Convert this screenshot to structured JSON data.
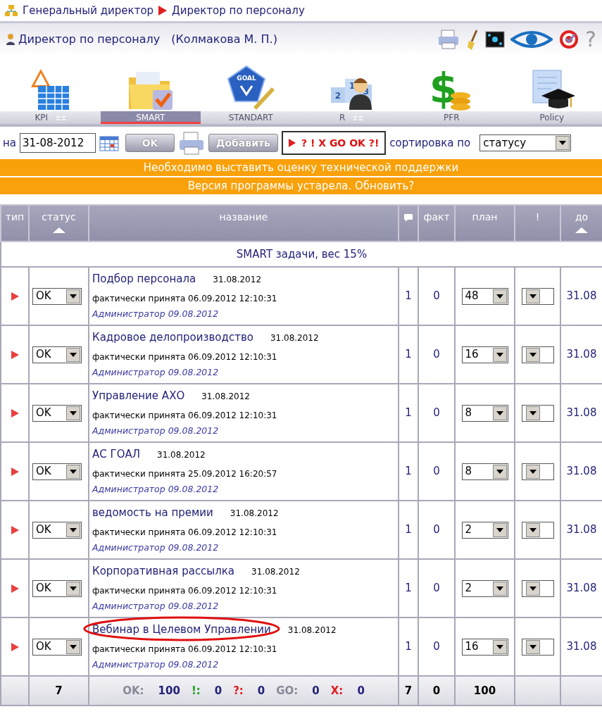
{
  "breadcrumb": [
    {
      "label": "Генеральный директор"
    },
    {
      "label": "Директор по персоналу"
    }
  ],
  "header": {
    "title": "Директор по персоналу",
    "person": "(Колмакова М. П.)",
    "help": "?"
  },
  "modules": [
    {
      "kind": "kpi"
    },
    {
      "kind": "smart"
    },
    {
      "kind": "goal",
      "badge": "GOAL"
    },
    {
      "kind": "rank",
      "podium": [
        "2",
        "1",
        "3"
      ]
    },
    {
      "kind": "money",
      "symbol": "$"
    },
    {
      "kind": "policy"
    }
  ],
  "tabs": [
    {
      "label": "KPI",
      "has_menu": true,
      "selected": false
    },
    {
      "label": "SMART",
      "has_menu": false,
      "selected": true
    },
    {
      "label": "STANDART",
      "has_menu": false,
      "selected": false
    },
    {
      "label": "R",
      "has_menu": true,
      "selected": false
    },
    {
      "label": "PFR",
      "has_menu": false,
      "selected": false
    },
    {
      "label": "Policy",
      "has_menu": false,
      "selected": false
    }
  ],
  "toolbar": {
    "date_label": "на",
    "date": "31-08-2012",
    "ok": "OK",
    "add": "Добавить",
    "filter": "? ! X GO OK ?!",
    "sort_label": "сортировка по",
    "sort_value": "статусу"
  },
  "notices": [
    "Необходимо выставить оценку технической поддержки",
    "Версия программы устарела. Обновить?"
  ],
  "table": {
    "columns": [
      {
        "label": "тип",
        "sorted": false
      },
      {
        "label": "статус",
        "sorted": true
      },
      {
        "label": "название",
        "sorted": false
      },
      {
        "sorted": false,
        "kind": "comment"
      },
      {
        "label": "факт",
        "sorted": false
      },
      {
        "label": "план",
        "sorted": false
      },
      {
        "label": "!",
        "sorted": false
      },
      {
        "label": "до",
        "sorted": true
      }
    ],
    "group": "SMART задачи, вес 15%",
    "rows": [
      {
        "status": "OK",
        "name": "Подбор персонала",
        "date": "31.08.2012",
        "detail": "фактически принята 06.09.2012 12:10:31",
        "author": "Администратор 09.08.2012",
        "comments": "1",
        "fact": "0",
        "plan": "48",
        "priority": "",
        "due": "31.08",
        "circled": false
      },
      {
        "status": "OK",
        "name": "Кадровое делопроизводство",
        "date": "31.08.2012",
        "detail": "фактически принята 06.09.2012 12:10:31",
        "author": "Администратор 09.08.2012",
        "comments": "1",
        "fact": "0",
        "plan": "16",
        "priority": "",
        "due": "31.08",
        "circled": false
      },
      {
        "status": "OK",
        "name": "Управление АХО",
        "date": "31.08.2012",
        "detail": "фактически принята 06.09.2012 12:10:31",
        "author": "Администратор 09.08.2012",
        "comments": "1",
        "fact": "0",
        "plan": "8",
        "priority": "",
        "due": "31.08",
        "circled": false
      },
      {
        "status": "OK",
        "name": "АС ГОАЛ",
        "date": "31.08.2012",
        "detail": "фактически принята 25.09.2012 16:20:57",
        "author": "Администратор 09.08.2012",
        "comments": "1",
        "fact": "0",
        "plan": "8",
        "priority": "",
        "due": "31.08",
        "circled": false
      },
      {
        "status": "OK",
        "name": "ведомость на премии",
        "date": "31.08.2012",
        "detail": "фактически принята 06.09.2012 12:10:31",
        "author": "Администратор 09.08.2012",
        "comments": "1",
        "fact": "0",
        "plan": "2",
        "priority": "",
        "due": "31.08",
        "circled": false
      },
      {
        "status": "OK",
        "name": "Корпоративная рассылка",
        "date": "31.08.2012",
        "detail": "фактически принята 06.09.2012 12:10:31",
        "author": "Администратор 09.08.2012",
        "comments": "1",
        "fact": "0",
        "plan": "2",
        "priority": "",
        "due": "31.08",
        "circled": false
      },
      {
        "status": "OK",
        "name": "Вебинар в Целевом Управлении",
        "date": "31.08.2012",
        "detail": "фактически принята 06.09.2012 12:10:31",
        "author": "Администратор 09.08.2012",
        "comments": "1",
        "fact": "0",
        "plan": "16",
        "priority": "",
        "due": "31.08",
        "circled": true
      }
    ],
    "footer": {
      "count": "7",
      "summary": [
        {
          "label": "OK:",
          "value": "100",
          "color": "#8a8a9a"
        },
        {
          "label": "!:",
          "value": "0",
          "color": "#20a020"
        },
        {
          "label": "?:",
          "value": "0",
          "color": "#e02020"
        },
        {
          "label": "GO:",
          "value": "0",
          "color": "#8a8a9a"
        },
        {
          "label": "X:",
          "value": "0",
          "color": "#e02020"
        }
      ],
      "comments": "7",
      "fact": "0",
      "plan": "100"
    }
  }
}
